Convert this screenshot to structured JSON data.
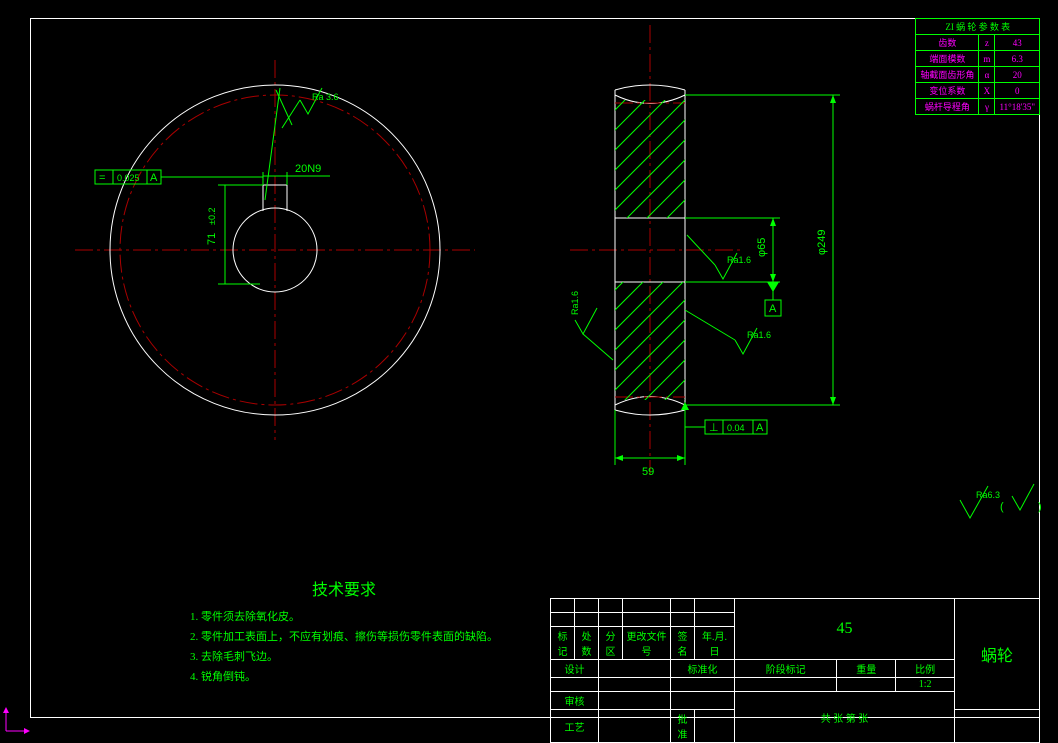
{
  "param_table": {
    "title": "ZI 蜗 轮 参 数 表",
    "rows": [
      {
        "name": "齿数",
        "sym": "z",
        "val": "43"
      },
      {
        "name": "端面模数",
        "sym": "m",
        "val": "6.3"
      },
      {
        "name": "轴截面齿形角",
        "sym": "α",
        "val": "20"
      },
      {
        "name": "变位系数",
        "sym": "X",
        "val": "0"
      },
      {
        "name": "蜗杆导程角",
        "sym": "γ",
        "val": "11°18'35\""
      }
    ]
  },
  "fcf1": {
    "gtol_sym": "◎",
    "val": "0.025",
    "datum": "A"
  },
  "fcf2": {
    "gtol_sym": "⊥",
    "val": "0.04",
    "datum": "A"
  },
  "dim_key": "20N9",
  "dim_71": "71",
  "dim_71_tol": "±0.2",
  "ra_top": "Ra 3.6",
  "ra1": "Ra1.6",
  "ra2": "Ra1.6",
  "ra3": "Ra1.6",
  "dim_phi65": "φ65",
  "dim_phi249": "φ249",
  "dim_59": "59",
  "datum_a": "A",
  "surface_global": "Ra6.3",
  "tech": {
    "title": "技术要求",
    "items": [
      "1. 零件须去除氧化皮。",
      "2. 零件加工表面上，不应有划痕、擦伤等损伤零件表面的缺陷。",
      "3. 去除毛刺飞边。",
      "4. 锐角倒钝。"
    ]
  },
  "title_block": {
    "cols1": [
      "标记",
      "处数",
      "分区",
      "更改文件号",
      "签名",
      "年.月.日"
    ],
    "rows1": [
      "设计",
      "审核",
      "工艺"
    ],
    "std": "标准化",
    "appr": "批准",
    "material": "45",
    "name": "蜗轮",
    "stage": "阶段标记",
    "mass": "重量",
    "scale": "比例",
    "scale_v": "1:2",
    "sheet": "共    张    第    张"
  }
}
